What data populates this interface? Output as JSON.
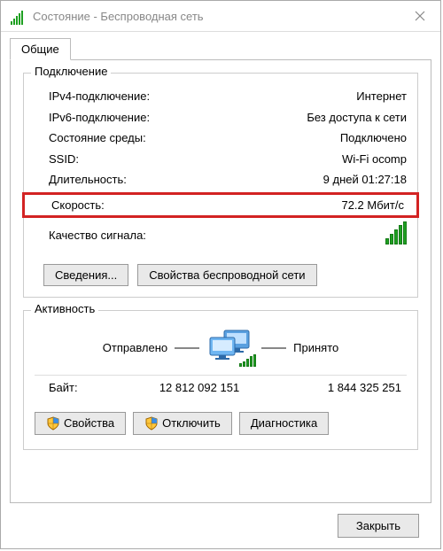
{
  "window": {
    "title": "Состояние - Беспроводная сеть"
  },
  "tab": {
    "label": "Общие"
  },
  "group_connection": {
    "legend": "Подключение",
    "ipv4_label": "IPv4-подключение:",
    "ipv4_value": "Интернет",
    "ipv6_label": "IPv6-подключение:",
    "ipv6_value": "Без доступа к сети",
    "media_label": "Состояние среды:",
    "media_value": "Подключено",
    "ssid_label": "SSID:",
    "ssid_value": "Wi-Fi ocomp",
    "duration_label": "Длительность:",
    "duration_value": "9 дней 01:27:18",
    "speed_label": "Скорость:",
    "speed_value": "72.2 Мбит/с",
    "signal_label": "Качество сигнала:",
    "details_btn": "Сведения...",
    "wifi_btn": "Свойства беспроводной сети"
  },
  "group_activity": {
    "legend": "Активность",
    "sent_label": "Отправлено",
    "recv_label": "Принято",
    "bytes_label": "Байт:",
    "bytes_sent": "12 812 092 151",
    "bytes_recv": "1 844 325 251",
    "properties_btn": "Свойства",
    "disable_btn": "Отключить",
    "diagnose_btn": "Диагностика"
  },
  "footer": {
    "close_btn": "Закрыть"
  }
}
